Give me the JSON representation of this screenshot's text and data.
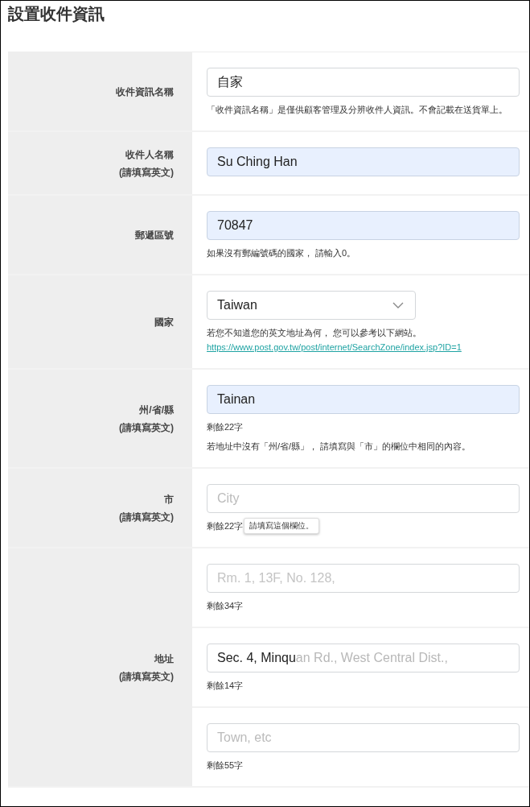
{
  "title": "設置收件資訊",
  "rows": [
    {
      "label": "收件資訊名稱",
      "fields": [
        {
          "kind": "input",
          "value": "自家",
          "autofilled": false,
          "notes": [
            "「收件資訊名稱」是僅供顧客管理及分辨收件人資訊。不會記載在送貨單上。"
          ]
        }
      ]
    },
    {
      "label": "收件人名稱",
      "sublabel": "(請填寫英文)",
      "fields": [
        {
          "kind": "input",
          "value": "Su Ching Han",
          "autofilled": true
        }
      ]
    },
    {
      "label": "郵遞區號",
      "fields": [
        {
          "kind": "input",
          "value": "70847",
          "autofilled": true,
          "notes": [
            "如果沒有郵編號碼的國家， 請輸入0。"
          ]
        }
      ]
    },
    {
      "label": "國家",
      "fields": [
        {
          "kind": "select",
          "value": "Taiwan",
          "notes": [
            "若您不知道您的英文地址為何， 您可以參考以下網站。"
          ],
          "link": "https://www.post.gov.tw/post/internet/SearchZone/index.jsp?ID=1"
        }
      ]
    },
    {
      "label": "州/省/縣",
      "sublabel": "(請填寫英文)",
      "fields": [
        {
          "kind": "input",
          "value": "Tainan",
          "autofilled": true,
          "counter": "剩餘22字",
          "notes": [
            "若地址中沒有「州/省/縣」， 請填寫與「市」的欄位中相同的內容。"
          ]
        }
      ]
    },
    {
      "label": "市",
      "sublabel": "(請填寫英文)",
      "fields": [
        {
          "kind": "input",
          "placeholder": "City",
          "autofilled": false,
          "counter": "剩餘22字",
          "tooltip": "請填寫這個欄位。"
        }
      ]
    },
    {
      "label": "地址",
      "sublabel": "(請填寫英文)",
      "fields": [
        {
          "kind": "input",
          "placeholder": "Rm. 1, 13F, No. 128,",
          "faint": true,
          "autofilled": false,
          "counter": "剩餘34字"
        },
        {
          "kind": "input",
          "value": "Sec. 4, Minqu",
          "faded": "an Rd., West Central Dist.,",
          "autofilled": false,
          "counter": "剩餘14字"
        },
        {
          "kind": "input",
          "placeholder": "Town, etc",
          "autofilled": false,
          "counter": "剩餘55字"
        }
      ]
    }
  ]
}
